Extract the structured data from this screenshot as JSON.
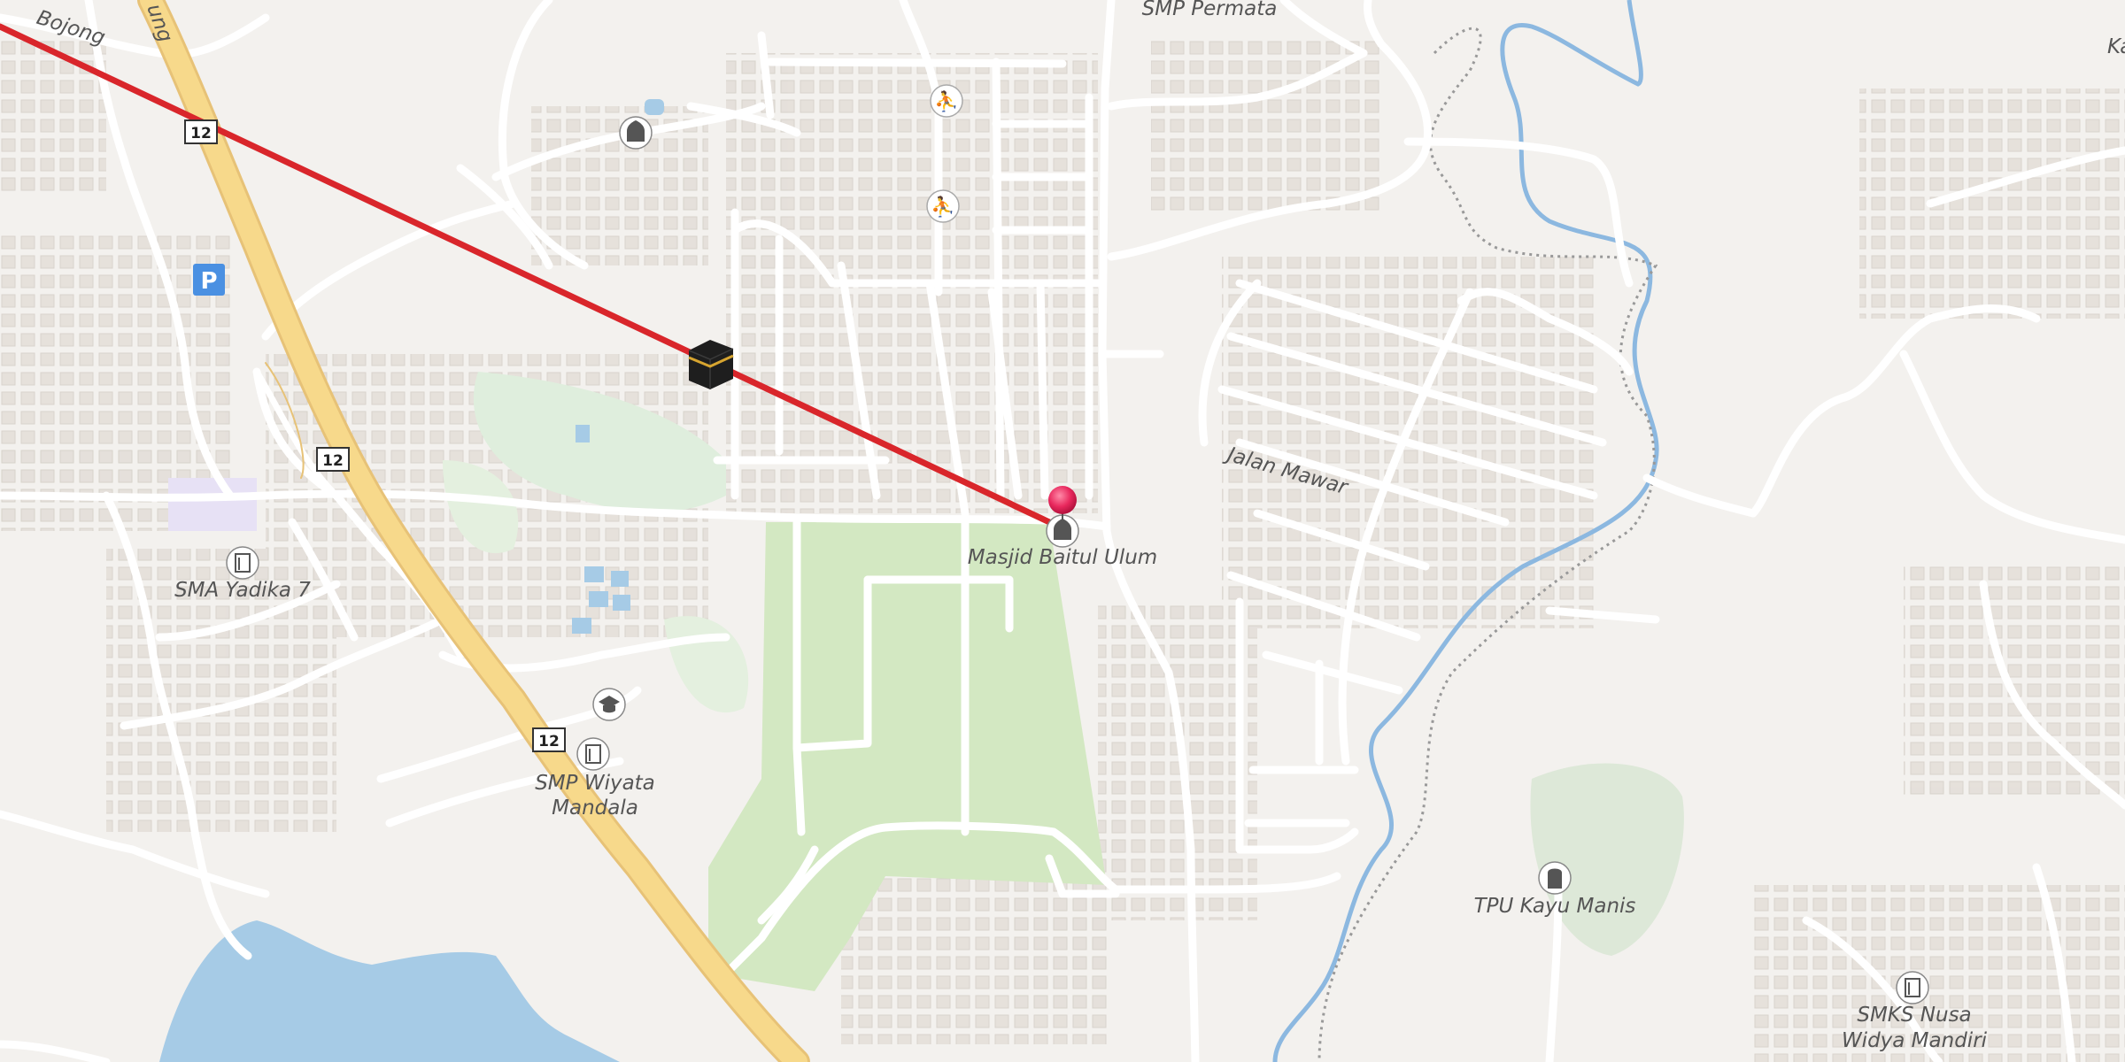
{
  "map": {
    "labels": {
      "smp_permata": "SMP Permata",
      "jalan_mawar": "Jalan Mawar",
      "masjid": "Masjid Baitul Ulum",
      "sma": "SMA Yadika 7",
      "smp_wiyata_1": "SMP Wiyata",
      "smp_wiyata_2": "Mandala",
      "tpu": "TPU Kayu Manis",
      "smks_1": "SMKS Nusa",
      "smks_2": "Widya Mandiri",
      "bojong": "Bojong",
      "edge_top_left": "ung",
      "edge_top_right": "Ka"
    },
    "road_shields": [
      "12",
      "12",
      "12"
    ],
    "parking_symbol": "P",
    "icons": [
      "kaaba-icon",
      "location-pin-icon",
      "mosque-icon",
      "school-icon",
      "graduation-cap-icon",
      "sports-icon",
      "cemetery-icon",
      "parking-icon"
    ],
    "colors": {
      "background": "#f3f1ee",
      "qibla_line": "#d9262b",
      "pin": "#e8285d",
      "primary_road": "#f7d98b",
      "park": "#d3e8c2",
      "water": "#a6cbe6",
      "river": "#8cb8e0",
      "parking": "#4a90e2"
    }
  }
}
